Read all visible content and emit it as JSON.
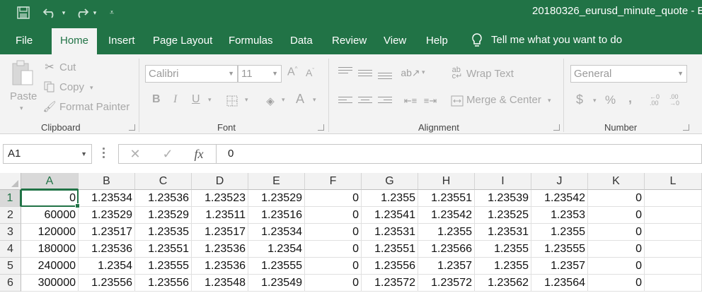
{
  "titlebar": {
    "title": "20180326_eurusd_minute_quote  -  E",
    "qat": [
      "save-icon",
      "undo-icon",
      "redo-icon",
      "customize-icon"
    ],
    "color": "#217346"
  },
  "menu": {
    "tabs": [
      "File",
      "Home",
      "Insert",
      "Page Layout",
      "Formulas",
      "Data",
      "Review",
      "View",
      "Help"
    ],
    "active": "Home",
    "tell_me": "Tell me what you want to do"
  },
  "ribbon": {
    "clipboard": {
      "paste": "Paste",
      "cut": "Cut",
      "copy": "Copy",
      "format_painter": "Format Painter",
      "label": "Clipboard"
    },
    "font": {
      "name": "Calibri",
      "size": "11",
      "bold": "B",
      "italic": "I",
      "underline": "U",
      "font_color": "A",
      "grow": "A",
      "shrink": "A",
      "label": "Font"
    },
    "alignment": {
      "wrap_text": "Wrap Text",
      "merge_center": "Merge & Center",
      "label": "Alignment"
    },
    "number": {
      "format": "General",
      "currency": "$",
      "percent": "%",
      "comma": ",",
      "inc_decimal": ".00",
      "dec_decimal": ".00",
      "label": "Number"
    }
  },
  "formula_bar": {
    "name_box": "A1",
    "fx": "fx",
    "value": "0"
  },
  "sheet": {
    "columns": [
      "A",
      "B",
      "C",
      "D",
      "E",
      "F",
      "G",
      "H",
      "I",
      "J",
      "K",
      "L"
    ],
    "selected_column": "A",
    "selected_row": "1",
    "rows": [
      {
        "num": "1",
        "cells": [
          "0",
          "1.23534",
          "1.23536",
          "1.23523",
          "1.23529",
          "0",
          "1.2355",
          "1.23551",
          "1.23539",
          "1.23542",
          "0",
          ""
        ]
      },
      {
        "num": "2",
        "cells": [
          "60000",
          "1.23529",
          "1.23529",
          "1.23511",
          "1.23516",
          "0",
          "1.23541",
          "1.23542",
          "1.23525",
          "1.2353",
          "0",
          ""
        ]
      },
      {
        "num": "3",
        "cells": [
          "120000",
          "1.23517",
          "1.23535",
          "1.23517",
          "1.23534",
          "0",
          "1.23531",
          "1.2355",
          "1.23531",
          "1.2355",
          "0",
          ""
        ]
      },
      {
        "num": "4",
        "cells": [
          "180000",
          "1.23536",
          "1.23551",
          "1.23536",
          "1.2354",
          "0",
          "1.23551",
          "1.23566",
          "1.2355",
          "1.23555",
          "0",
          ""
        ]
      },
      {
        "num": "5",
        "cells": [
          "240000",
          "1.2354",
          "1.23555",
          "1.23536",
          "1.23555",
          "0",
          "1.23556",
          "1.2357",
          "1.2355",
          "1.2357",
          "0",
          ""
        ]
      },
      {
        "num": "6",
        "cells": [
          "300000",
          "1.23556",
          "1.23556",
          "1.23548",
          "1.23549",
          "0",
          "1.23572",
          "1.23572",
          "1.23562",
          "1.23564",
          "0",
          ""
        ]
      }
    ]
  }
}
